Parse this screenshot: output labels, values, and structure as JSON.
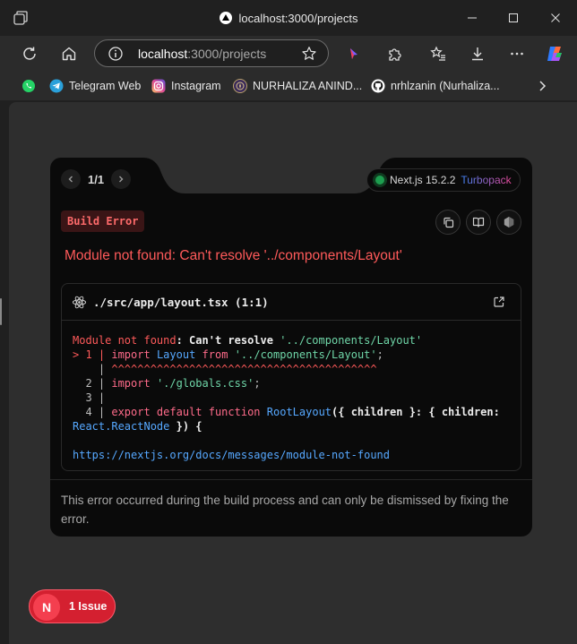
{
  "window": {
    "title": "localhost:3000/projects"
  },
  "toolbar": {
    "url_host": "localhost",
    "url_rest": ":3000/projects"
  },
  "bookmarks": [
    {
      "label": "",
      "icon": "whatsapp-icon"
    },
    {
      "label": "Telegram Web",
      "icon": "telegram-icon"
    },
    {
      "label": "Instagram",
      "icon": "instagram-icon"
    },
    {
      "label": "NURHALIZA ANIND...",
      "icon": "university-seal-icon"
    },
    {
      "label": "nrhlzanin (Nurhaliza...",
      "icon": "github-icon"
    }
  ],
  "overlay": {
    "pager": "1/1",
    "version": "Next.js 15.2.2",
    "bundler": "Turbopack",
    "badge": "Build Error",
    "title": "Module not found: Can't resolve '../components/Layout'",
    "file": "./src/app/layout.tsx (1:1)",
    "code": {
      "l1_a": "Module not found",
      "l1_b": ": Can't resolve ",
      "l1_c": "'../components/Layout'",
      "l2_prefix": "> 1 | ",
      "l2_kw1": "import",
      "l2_name": "Layout",
      "l2_kw2": "from",
      "l2_str": "'../components/Layout'",
      "l2_end": ";",
      "l3_prefix": "    | ",
      "l3_caret": "^^^^^^^^^^^^^^^^^^^^^^^^^^^^^^^^^^^^^^^^^",
      "l4_prefix": "  2 | ",
      "l4_kw": "import",
      "l4_str": "'./globals.css'",
      "l4_end": ";",
      "l5_prefix": "  3 |",
      "l6_prefix": "  4 | ",
      "l6_kw": "export default function",
      "l6_fn": "RootLayout",
      "l6_rest1": "({ children }: { children:",
      "l7_type": "React.ReactNode",
      "l7_rest": " }) {",
      "link": "https://nextjs.org/docs/messages/module-not-found"
    },
    "footer": "This error occurred during the build process and can only be dismissed by fixing the error."
  },
  "issues": {
    "badge_letter": "N",
    "label": "1 Issue"
  },
  "colors": {
    "error_red": "#ff5a5a",
    "issue_pill": "#d42030",
    "link_blue": "#56a8ff"
  }
}
